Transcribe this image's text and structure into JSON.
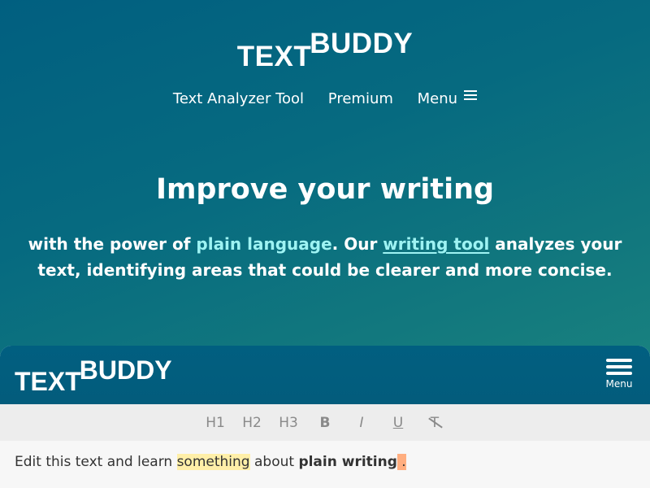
{
  "site": {
    "logo_text": "TEXT",
    "logo_buddy": "BUDDY",
    "nav": [
      {
        "label": "Text Analyzer Tool"
      },
      {
        "label": "Premium"
      },
      {
        "label": "Menu"
      }
    ]
  },
  "hero": {
    "title": "Improve your writing",
    "sub_pre": "with the power of ",
    "sub_accent": "plain language",
    "sub_mid": ". Our ",
    "sub_link": "writing tool",
    "sub_post": " analyzes your text, identifying areas that could be clearer and more concise."
  },
  "app": {
    "logo_text": "TEXT",
    "logo_buddy": "BUDDY",
    "menu_label": "Menu",
    "toolbar": [
      "H1",
      "H2",
      "H3",
      "B",
      "I",
      "U",
      "T"
    ],
    "editor": {
      "pre": "Edit this text and learn ",
      "highlight_word": "something",
      "mid": " about ",
      "bold": "plain writing",
      "flag": " .",
      "flag_color": "#ffae80",
      "highlight_color": "#ffefa8"
    }
  },
  "colors": {
    "primary": "#015f80",
    "accent": "#9ef3f3"
  }
}
